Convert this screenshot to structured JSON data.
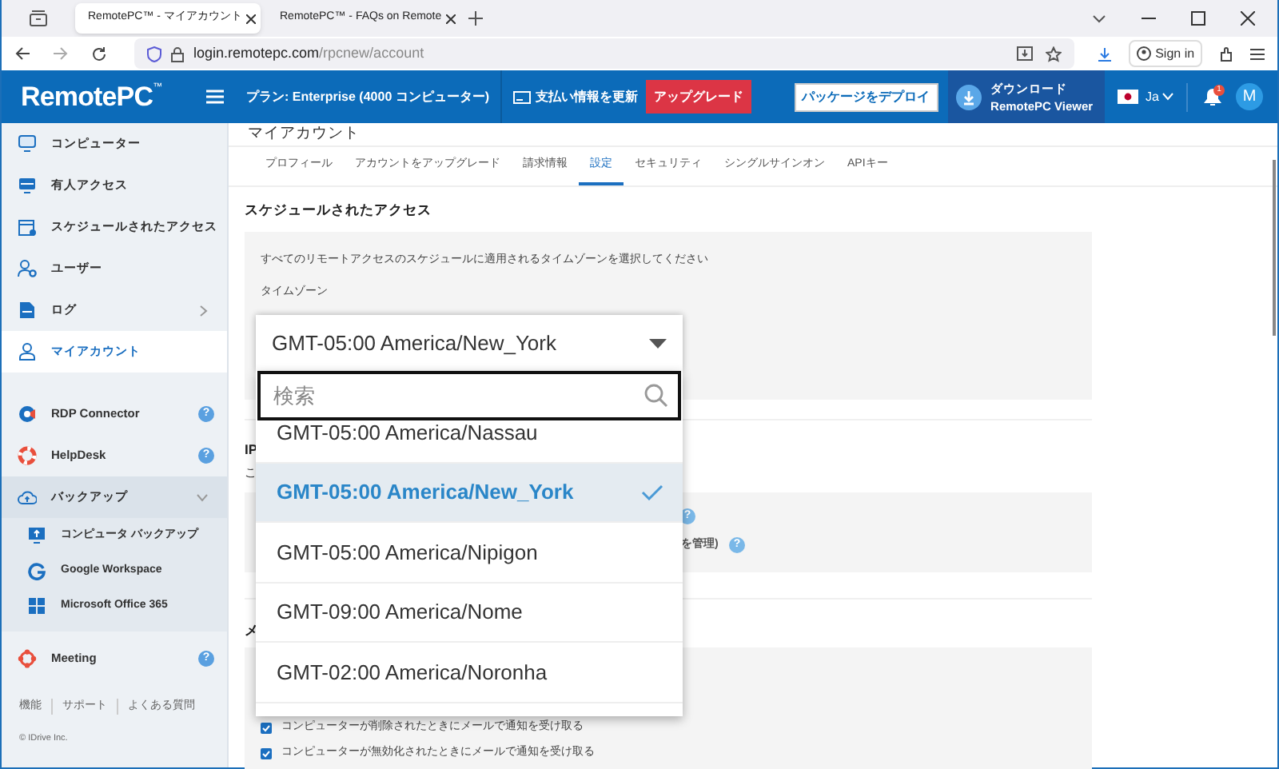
{
  "browser": {
    "tabs": [
      {
        "title": "RemotePC™ - マイアカウント",
        "selected": true
      },
      {
        "title": "RemotePC™ - FAQs on Remote",
        "selected": false
      }
    ],
    "url_host": "login.remotepc.com",
    "url_path": "/rpcnew/account",
    "sign_in": "Sign in"
  },
  "header": {
    "logo": "RemotePC",
    "logo_mark": "™",
    "plan": "プラン: Enterprise (4000 コンピューター)",
    "billing": "支払い情報を更新",
    "upgrade": "アップグレード",
    "deploy": "パッケージをデプロイ",
    "download_line1": "ダウンロード",
    "download_line2": "RemotePC Viewer",
    "language": "Ja",
    "notifications": "1",
    "avatar": "M"
  },
  "sidebar": {
    "items": [
      {
        "label": "コンピューター",
        "selected": false
      },
      {
        "label": "有人アクセス",
        "selected": false
      },
      {
        "label": "スケジュールされたアクセス",
        "selected": false
      },
      {
        "label": "ユーザー",
        "selected": false
      },
      {
        "label": "ログ",
        "selected": false,
        "expanded": false
      },
      {
        "label": "マイアカウント",
        "selected": true
      }
    ],
    "apps": [
      {
        "label": "RDP Connector",
        "help": "?"
      },
      {
        "label": "HelpDesk",
        "help": "?"
      },
      {
        "label": "バックアップ",
        "expanded": true,
        "children": [
          {
            "label": "コンピュータ バックアップ"
          },
          {
            "label": "Google Workspace"
          },
          {
            "label": "Microsoft Office 365"
          }
        ]
      },
      {
        "label": "Meeting",
        "help": "?"
      }
    ],
    "footer_links": [
      "機能",
      "サポート",
      "よくある質問"
    ],
    "copyright": "© IDrive Inc."
  },
  "main": {
    "title": "マイアカウント",
    "tabs": [
      {
        "label": "プロフィール",
        "selected": false
      },
      {
        "label": "アカウントをアップグレード",
        "selected": false
      },
      {
        "label": "請求情報",
        "selected": false
      },
      {
        "label": "設定",
        "selected": true
      },
      {
        "label": "セキュリティ",
        "selected": false
      },
      {
        "label": "シングルサインオン",
        "selected": false
      },
      {
        "label": "APIキー",
        "selected": false
      }
    ],
    "schedule": {
      "heading": "スケジュールされたアクセス",
      "description": "すべてのリモートアクセスのスケジュールに適用されるタイムゾーンを選択してください",
      "field_label": "タイムゾーン"
    },
    "ip_section": {
      "heading": "IP",
      "text": "こ",
      "row_text": "を管理)",
      "help_marks": [
        "?",
        "?"
      ]
    },
    "mail_section": {
      "heading": "メ",
      "options": [
        {
          "label": "コンピューターが削除されたときにメールで通知を受け取る",
          "checked": true
        },
        {
          "label": "コンピューターが無効化されたときにメールで通知を受け取る",
          "checked": true
        }
      ]
    }
  },
  "timezone_dropdown": {
    "value": "GMT-05:00 America/New_York",
    "search_placeholder": "検索",
    "options": [
      {
        "label": "GMT-05:00 America/Nassau",
        "selected": false
      },
      {
        "label": "GMT-05:00 America/New_York",
        "selected": true
      },
      {
        "label": "GMT-05:00 America/Nipigon",
        "selected": false
      },
      {
        "label": "GMT-09:00 America/Nome",
        "selected": false
      },
      {
        "label": "GMT-02:00 America/Noronha",
        "selected": false
      }
    ]
  }
}
